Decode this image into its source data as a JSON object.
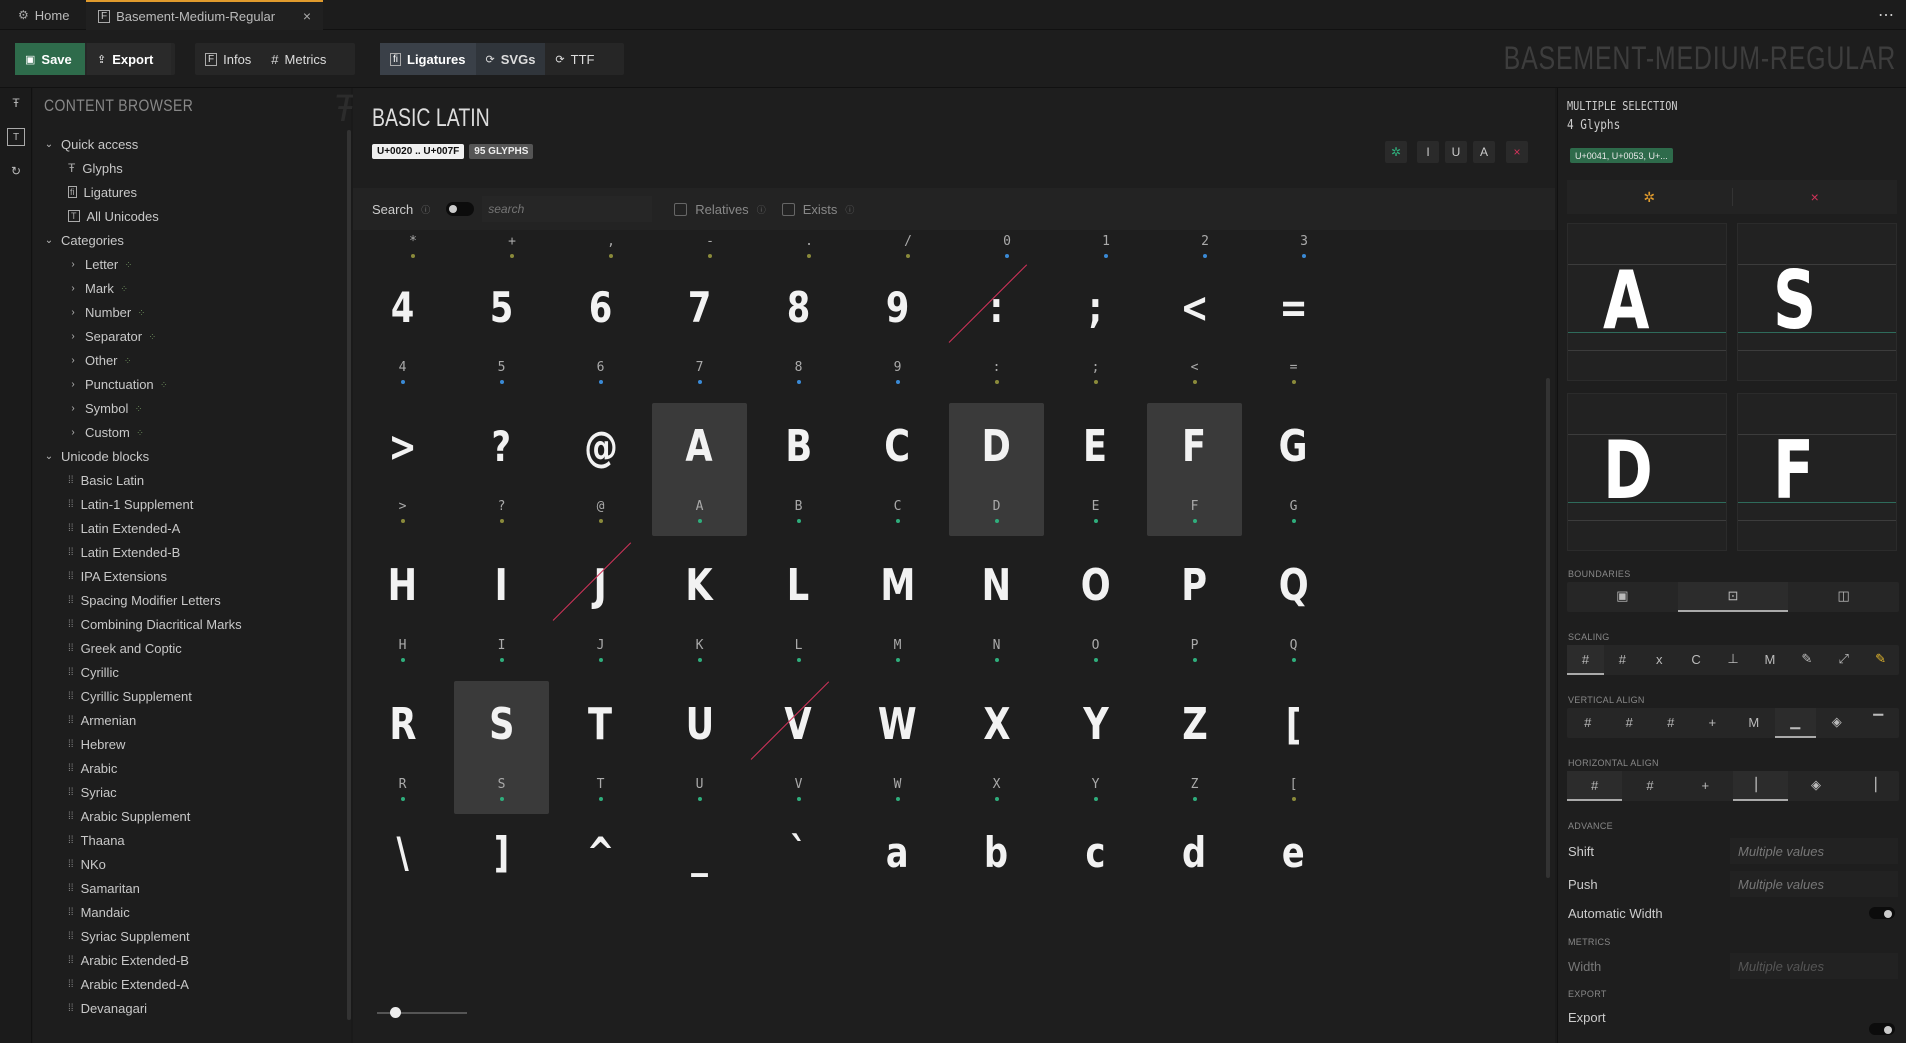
{
  "tabs": [
    {
      "label": "Home",
      "icon": "gear-icon"
    },
    {
      "label": "Basement-Medium-Regular",
      "icon": "font-file-icon",
      "close": "×"
    }
  ],
  "menu_dots": "⋯",
  "toolbar": {
    "save": "Save",
    "export": "Export",
    "infos": "Infos",
    "metrics": "Metrics",
    "ligatures": "Ligatures",
    "svgs": "SVGs",
    "ttf": "TTF",
    "watermark": "BASEMENT-MEDIUM-REGULAR"
  },
  "browser": {
    "title": "CONTENT BROWSER",
    "quick_access": {
      "label": "Quick access",
      "items": [
        "Glyphs",
        "Ligatures",
        "All Unicodes"
      ]
    },
    "categories": {
      "label": "Categories",
      "items": [
        "Letter",
        "Mark",
        "Number",
        "Separator",
        "Other",
        "Punctuation",
        "Symbol",
        "Custom"
      ]
    },
    "unicode_blocks": {
      "label": "Unicode blocks",
      "items": [
        "Basic Latin",
        "Latin-1 Supplement",
        "Latin Extended-A",
        "Latin Extended-B",
        "IPA Extensions",
        "Spacing Modifier Letters",
        "Combining Diacritical Marks",
        "Greek and Coptic",
        "Cyrillic",
        "Cyrillic Supplement",
        "Armenian",
        "Hebrew",
        "Arabic",
        "Syriac",
        "Arabic Supplement",
        "Thaana",
        "NKo",
        "Samaritan",
        "Mandaic",
        "Syriac Supplement",
        "Arabic Extended-B",
        "Arabic Extended-A",
        "Devanagari"
      ]
    }
  },
  "main": {
    "title": "BASIC LATIN",
    "range": "U+0020 .. U+007F",
    "count": "95 GLYPHS",
    "search_label": "Search",
    "search_placeholder": "search",
    "relatives": "Relatives",
    "exists": "Exists",
    "top_row": [
      "*",
      "+",
      ",",
      "-",
      ".",
      "/",
      "0",
      "1",
      "2",
      "3"
    ],
    "rows": [
      [
        "4",
        "5",
        "6",
        "7",
        "8",
        "9",
        ":",
        ";",
        "<",
        "="
      ],
      [
        ">",
        "?",
        "@",
        "A",
        "B",
        "C",
        "D",
        "E",
        "F",
        "G"
      ],
      [
        "H",
        "I",
        "J",
        "K",
        "L",
        "M",
        "N",
        "O",
        "P",
        "Q"
      ],
      [
        "R",
        "S",
        "T",
        "U",
        "V",
        "W",
        "X",
        "Y",
        "Z",
        "["
      ]
    ],
    "partial_row": [
      "\\",
      "]",
      "^",
      "_",
      "`",
      "a",
      "b",
      "c",
      "d",
      "e"
    ],
    "selected": [
      "A",
      "D",
      "F",
      "S"
    ],
    "struck": [
      ":",
      "J",
      "V"
    ]
  },
  "right": {
    "header": "MULTIPLE SELECTION",
    "subheader": "4 Glyphs",
    "codes": "U+0041, U+0053, U+...",
    "previews": [
      "A",
      "S",
      "D",
      "F"
    ],
    "boundaries": "BOUNDARIES",
    "scaling": "SCALING",
    "vertical_align": "VERTICAL ALIGN",
    "horizontal_align": "HORIZONTAL ALIGN",
    "advance": "ADVANCE",
    "shift": "Shift",
    "push": "Push",
    "multiple_values": "Multiple values",
    "automatic_width": "Automatic Width",
    "metrics": "METRICS",
    "width": "Width",
    "export_section": "EXPORT",
    "export": "Export"
  },
  "colors": {
    "accent": "#e09b2d",
    "green": "#2e6b4b",
    "dot_green": "#2fae7c",
    "dot_blue": "#3a8ad6",
    "dot_olive": "#8a8a3a",
    "strike": "#d2335a"
  }
}
